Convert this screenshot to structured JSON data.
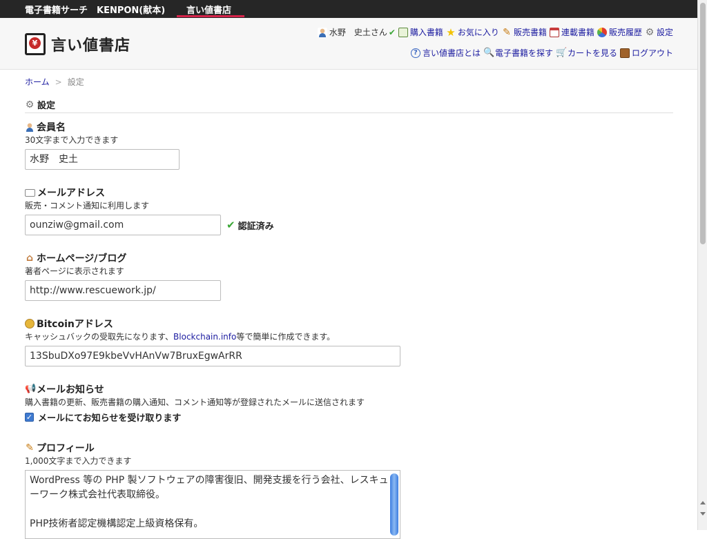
{
  "topbar": {
    "site1": "電子書籍サーチ　KENPON(献本)",
    "site2": "言い値書店"
  },
  "header": {
    "logo_text": "言い値書店",
    "logo_mark": "¥",
    "nav_row1": [
      {
        "icon": "user-icon",
        "label": "水野　史土さん"
      },
      {
        "icon": "book-icon",
        "label": "購入書籍"
      },
      {
        "icon": "star-icon",
        "label": "お気に入り"
      },
      {
        "icon": "pencil-icon",
        "label": "販売書籍"
      },
      {
        "icon": "calendar-icon",
        "label": "連載書籍"
      },
      {
        "icon": "pie-icon",
        "label": "販売履歴"
      },
      {
        "icon": "gear-icon",
        "label": "設定"
      }
    ],
    "nav_row2": [
      {
        "icon": "question-icon",
        "label": "言い値書店とは"
      },
      {
        "icon": "search-icon",
        "label": "電子書籍を探す"
      },
      {
        "icon": "cart-icon",
        "label": "カートを見る"
      },
      {
        "icon": "door-icon",
        "label": "ログアウト"
      }
    ]
  },
  "breadcrumb": {
    "home": "ホーム",
    "sep": ">",
    "current": "設定"
  },
  "page_title": "設定",
  "sections": {
    "member": {
      "title": "会員名",
      "desc": "30文字まで入力できます",
      "value": "水野　史土"
    },
    "email": {
      "title": "メールアドレス",
      "desc": "販売・コメント通知に利用します",
      "value": "ounziw@gmail.com",
      "verified": "認証済み"
    },
    "homepage": {
      "title": "ホームページ/ブログ",
      "desc": "著者ページに表示されます",
      "value": "http://www.rescuework.jp/"
    },
    "bitcoin": {
      "title": "Bitcoinアドレス",
      "desc_pre": "キャッシュバックの受取先になります、",
      "desc_link": "Blockchain.info",
      "desc_post": "等で簡単に作成できます。",
      "value": "13SbuDXo97E9kbeVvHAnVw7BruxEgwArRR"
    },
    "notify": {
      "title": "メールお知らせ",
      "desc": "購入書籍の更新、販売書籍の購入通知、コメント通知等が登録されたメールに送信されます",
      "checkbox_label": "メールにてお知らせを受け取ります",
      "checked": true
    },
    "profile": {
      "title": "プロフィール",
      "desc": "1,000文字まで入力できます",
      "lines": [
        "WordPress 等の PHP 製ソフトウェアの障害復旧、開発支援を行う会社、レスキュ",
        "ーワーク株式会社代表取締役。",
        "",
        "PHP技術者認定機構認定上級資格保有。"
      ]
    }
  },
  "colors": {
    "accent_line": "#d6234a",
    "link": "#1c1ca0",
    "verified": "#3aa635"
  }
}
